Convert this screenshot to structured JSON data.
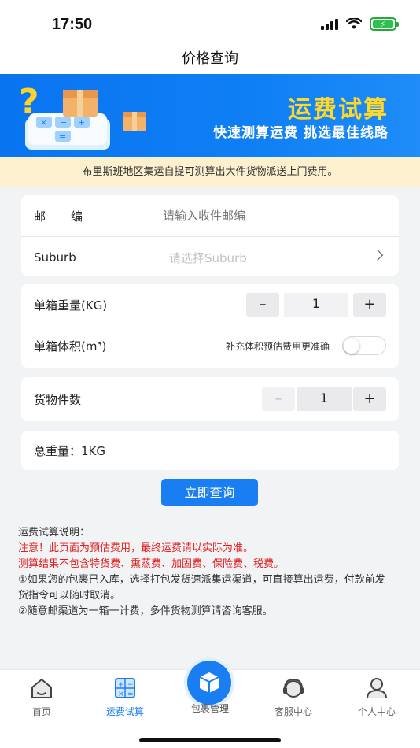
{
  "status": {
    "time": "17:50"
  },
  "nav": {
    "title": "价格查询"
  },
  "banner": {
    "title": "运费试算",
    "subtitle": "快速测算运费  挑选最佳线路"
  },
  "notice": "布里斯班地区集运自提可测算出大件货物派送上门费用。",
  "form": {
    "postcode": {
      "label": "邮编",
      "placeholder": "请输入收件邮编"
    },
    "suburb": {
      "label": "Suburb",
      "placeholder": "请选择Suburb"
    },
    "weight": {
      "label": "单箱重量(KG)",
      "minus": "–",
      "value": "1",
      "plus": "+"
    },
    "volume": {
      "label": "单箱体积(m³)",
      "hint": "补充体积预估费用更准确",
      "enabled": false
    },
    "pieces": {
      "label": "货物件数",
      "minus": "–",
      "value": "1",
      "plus": "+"
    },
    "total": {
      "label": "总重量：1KG"
    }
  },
  "query_button": "立即查询",
  "notes": {
    "title": "运费试算说明：",
    "warning1": "注意！此页面为预估费用，最终运费请以实际为准。",
    "warning2": "测算结果不包含特货费、熏蒸费、加固费、保险费、税费。",
    "item1": "①如果您的包裹已入库，选择打包发货速派集运渠道，可直接算出运费，付款前发货指令可以随时取消。",
    "item2": "②随意邮渠道为一箱一计费，多件货物测算请咨询客服。"
  },
  "tabs": [
    {
      "label": "首页",
      "icon": "home-icon",
      "active": false
    },
    {
      "label": "运费试算",
      "icon": "calculator-icon",
      "active": true
    },
    {
      "label": "包裹管理",
      "icon": "package-icon",
      "active": false
    },
    {
      "label": "客服中心",
      "icon": "headset-icon",
      "active": false
    },
    {
      "label": "个人中心",
      "icon": "user-icon",
      "active": false
    }
  ],
  "colors": {
    "primary": "#1a7ef3",
    "banner_title": "#ffd82a",
    "warning": "#e01e1e",
    "notice_bg": "#fdf0cf"
  }
}
